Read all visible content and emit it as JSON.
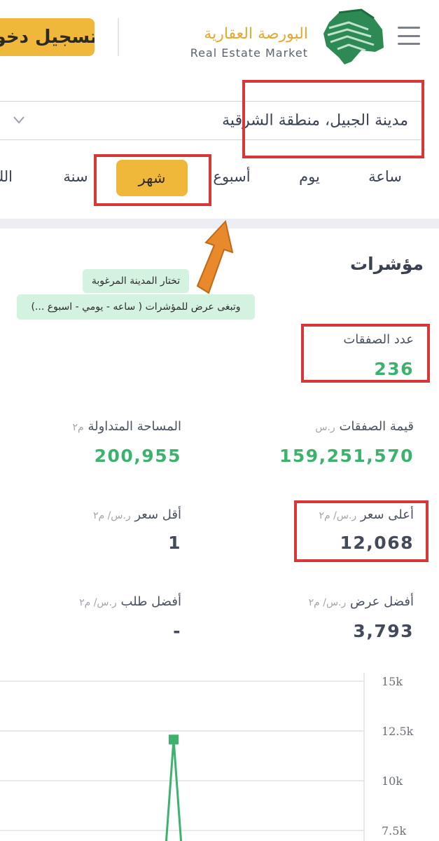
{
  "header": {
    "logo_arabic": "البورصة العقارية",
    "logo_english": "Real Estate Market",
    "login_button": "تسجيل دخول",
    "menu_icon": "hamburger-menu-icon"
  },
  "location_select": {
    "value": "مدينة الجبيل، منطقة الشرقية",
    "icon": "chevron-down-icon"
  },
  "period_tabs": [
    {
      "label": "ساعة",
      "active": false
    },
    {
      "label": "يوم",
      "active": false
    },
    {
      "label": "أسبوع",
      "active": false
    },
    {
      "label": "شهر",
      "active": true
    },
    {
      "label": "سنة",
      "active": false
    },
    {
      "label": "الك",
      "active": false
    }
  ],
  "annotation": {
    "line1": "تختار المدينة المرغوبة",
    "line2": "وتبغى عرض للمؤشرات ( ساعه - يومي - اسبوع ...)",
    "arrow_color": "#e8892c",
    "box_color": "#d83737"
  },
  "indicators": {
    "title": "مؤشرات",
    "deals_count": {
      "label": "عدد الصفقات",
      "value": "236"
    },
    "deals_value": {
      "label": "قيمة الصفقات",
      "unit": "ر.س",
      "value": "159,251,570"
    },
    "traded_area": {
      "label": "المساحة المتداولة",
      "unit": "م٢",
      "value": "200,955"
    },
    "highest_price": {
      "label": "أعلى سعر",
      "unit": "ر.س/ م٢",
      "value": "12,068"
    },
    "lowest_price": {
      "label": "أقل سعر",
      "unit": "ر.س/ م٢",
      "value": "1"
    },
    "best_offer": {
      "label": "أفضل عرض",
      "unit": "ر.س/ م٢",
      "value": "3,793"
    },
    "best_bid": {
      "label": "أفضل طلب",
      "unit": "ر.س/ م٢",
      "value": "-"
    }
  },
  "colors": {
    "accent": "#f0b83a",
    "positive": "#3bb36e",
    "text": "#3a4150"
  },
  "chart_data": {
    "type": "line",
    "y_ticks": [
      "15k",
      "12.5k",
      "10k",
      "7.5k"
    ],
    "ylim": [
      7000,
      15000
    ],
    "series": [
      {
        "values": [
          {
            "x": 0,
            "y": 0
          },
          {
            "x": 1,
            "y": 12068
          },
          {
            "x": 2,
            "y": 0
          }
        ]
      }
    ]
  }
}
